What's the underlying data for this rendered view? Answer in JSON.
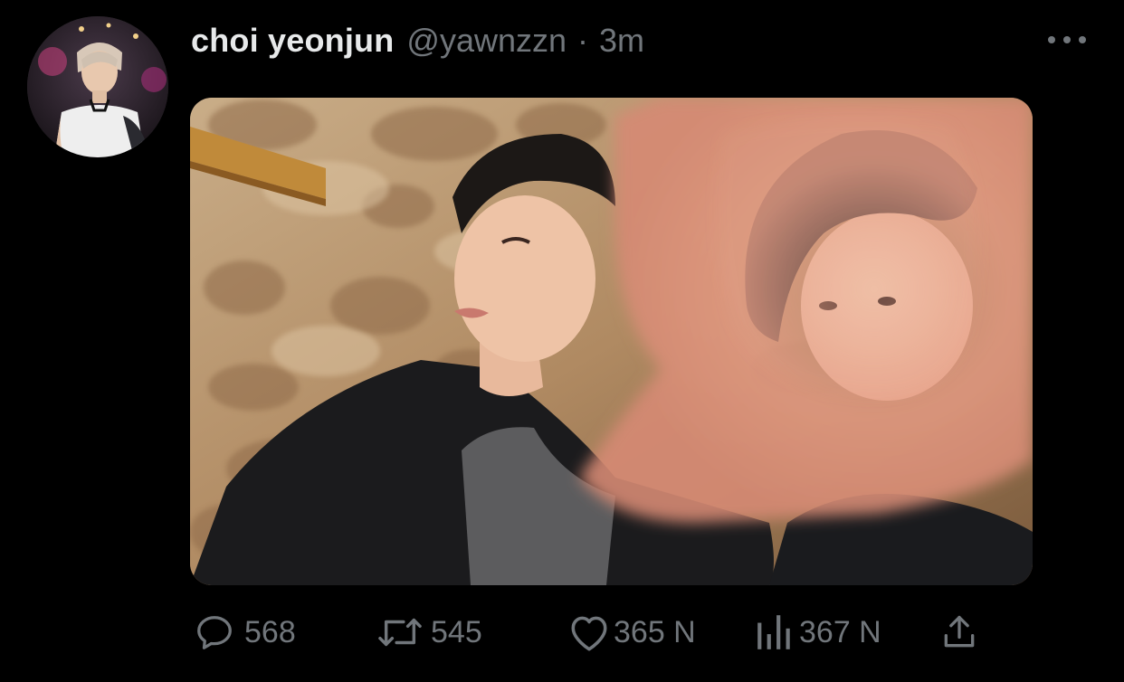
{
  "tweet": {
    "author_name": "choi yeonjun",
    "handle": "@yawnzzn",
    "separator": "·",
    "time": "3m"
  },
  "media": {
    "type": "photo"
  },
  "actions": {
    "reply_count": "568",
    "retweet_count": "545",
    "like_count": "365 N",
    "views_count": "367 N"
  },
  "icons": {
    "reply": "reply-bubble-icon",
    "retweet": "retweet-icon",
    "like": "heart-icon",
    "views": "views-bar-chart-icon",
    "share": "share-upload-icon",
    "more": "more-dots-icon"
  },
  "colors": {
    "background": "#000000",
    "primary_text": "#e7e9ea",
    "secondary_text": "#71767b"
  }
}
